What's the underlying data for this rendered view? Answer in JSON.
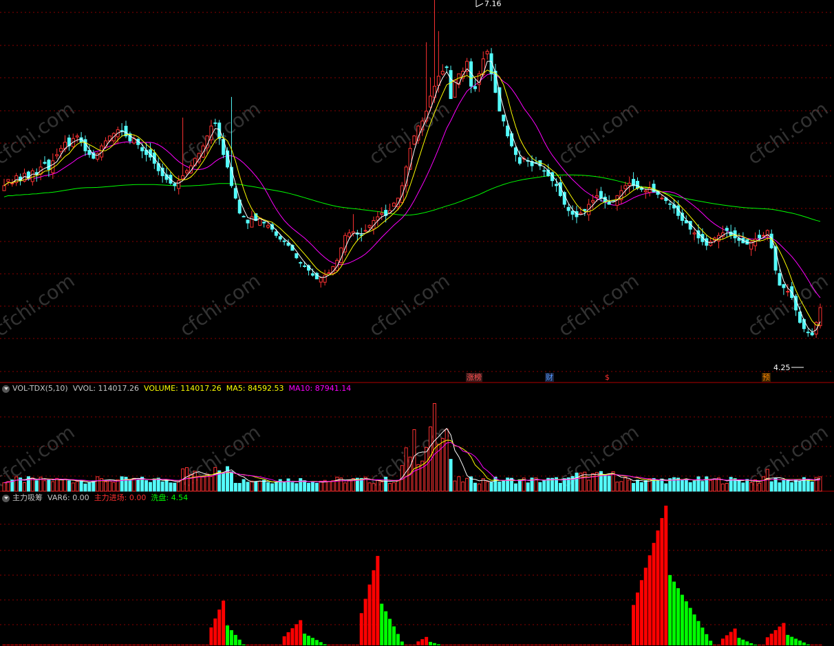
{
  "main_panel": {
    "high_label": "7.16",
    "low_label": "4.25",
    "event_marks": [
      {
        "text": "涨榜",
        "color": "#ff5050"
      },
      {
        "text": "财",
        "color": "#5599ff"
      },
      {
        "text": "$",
        "color": "#ff3030"
      },
      {
        "text": "预",
        "color": "#ff8800"
      }
    ],
    "watermark": "cfchi.com"
  },
  "volume_panel": {
    "indicator": "VOL-TDX(5,10)",
    "vvol": "VVOL: 114017.26",
    "volume": "VOLUME: 114017.26",
    "ma5": "MA5: 84592.53",
    "ma10": "MA10: 87941.14"
  },
  "capital_panel": {
    "indicator": "主力吸筹",
    "var6": "VAR6: 0.00",
    "main_in": "主力进场: 0.00",
    "wash": "洗盘: 4.54"
  },
  "colors": {
    "up": "#ff3232",
    "down": "#54fcfc",
    "ma5": "#ffffff",
    "ma10": "#ffff00",
    "ma20": "#ff00ff",
    "ma60": "#00ff00",
    "grid": "#8b0000",
    "bar_red": "#ff0000",
    "bar_green": "#00ff00"
  },
  "chart_data": {
    "type": "candlestick",
    "price_range": [
      4.25,
      7.16
    ],
    "volume_range": [
      0,
      3.2
    ],
    "capital_range": [
      0,
      10
    ],
    "closes": [
      5.7,
      5.75,
      5.72,
      5.78,
      5.74,
      5.8,
      5.76,
      5.82,
      5.79,
      5.85,
      5.88,
      5.83,
      5.9,
      5.95,
      6.0,
      6.05,
      6.02,
      6.08,
      6.1,
      6.05,
      5.98,
      5.95,
      5.92,
      5.96,
      6.02,
      6.06,
      6.1,
      6.12,
      6.15,
      6.14,
      6.1,
      6.06,
      6.08,
      6.03,
      5.98,
      5.95,
      5.93,
      5.88,
      5.82,
      5.78,
      5.75,
      5.72,
      5.7,
      5.74,
      5.78,
      5.82,
      5.86,
      5.92,
      5.96,
      6.02,
      6.1,
      6.18,
      6.2,
      6.08,
      5.95,
      5.85,
      5.7,
      5.6,
      5.48,
      5.45,
      5.4,
      5.45,
      5.42,
      5.44,
      5.4,
      5.38,
      5.35,
      5.3,
      5.27,
      5.25,
      5.22,
      5.18,
      5.12,
      5.08,
      5.05,
      5.02,
      4.98,
      4.95,
      4.96,
      4.98,
      5.0,
      5.05,
      5.1,
      5.2,
      5.3,
      5.32,
      5.33,
      5.31,
      5.3,
      5.34,
      5.38,
      5.42,
      5.45,
      5.48,
      5.46,
      5.5,
      5.56,
      5.6,
      5.7,
      5.85,
      6.0,
      6.1,
      6.18,
      6.22,
      6.3,
      6.42,
      6.5,
      6.58,
      6.62,
      6.65,
      6.4,
      6.55,
      6.6,
      6.62,
      6.7,
      6.5,
      6.48,
      6.6,
      6.72,
      6.78,
      6.6,
      6.45,
      6.3,
      6.22,
      6.1,
      6.02,
      5.95,
      5.88,
      5.92,
      5.9,
      5.86,
      5.88,
      5.86,
      5.82,
      5.78,
      5.74,
      5.7,
      5.62,
      5.55,
      5.5,
      5.47,
      5.45,
      5.48,
      5.5,
      5.55,
      5.58,
      5.62,
      5.6,
      5.57,
      5.55,
      5.58,
      5.62,
      5.66,
      5.7,
      5.72,
      5.7,
      5.68,
      5.67,
      5.66,
      5.68,
      5.65,
      5.63,
      5.6,
      5.58,
      5.55,
      5.52,
      5.46,
      5.42,
      5.4,
      5.35,
      5.32,
      5.28,
      5.25,
      5.22,
      5.25,
      5.28,
      5.3,
      5.32,
      5.34,
      5.3,
      5.28,
      5.26,
      5.24,
      5.23,
      5.25,
      5.27,
      5.28,
      5.3,
      5.34,
      5.2,
      5.02,
      4.9,
      4.88,
      4.85,
      4.8,
      4.7,
      4.6,
      4.55,
      4.52,
      4.5,
      4.6,
      4.72
    ]
  }
}
